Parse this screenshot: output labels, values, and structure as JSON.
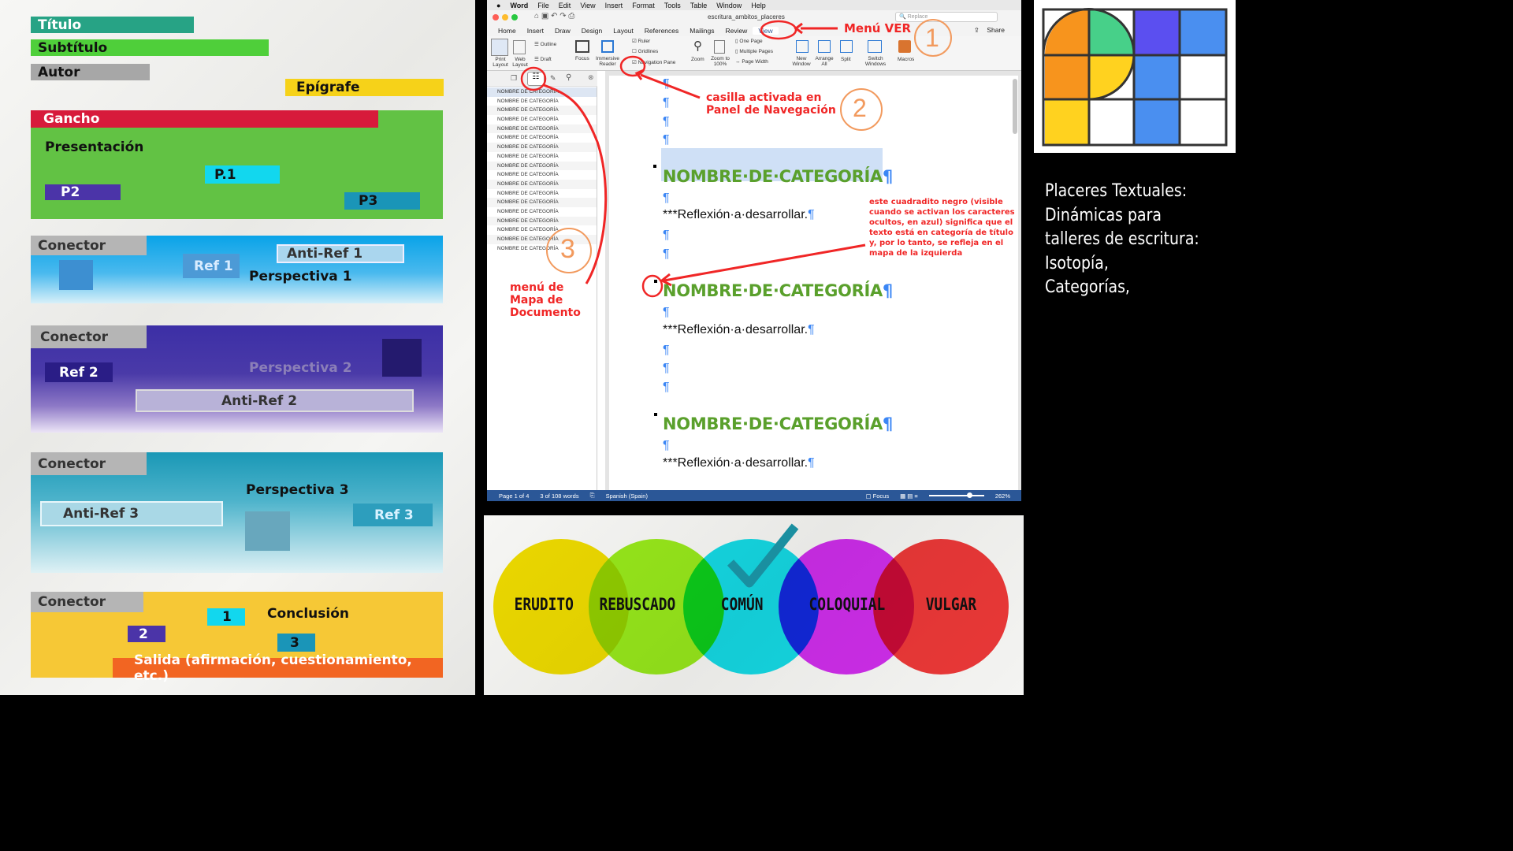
{
  "left": {
    "titulo": "Título",
    "subtitulo": "Subtítulo",
    "autor": "Autor",
    "epigrafe": "Epígrafe",
    "gancho": "Gancho",
    "presentacion": "Presentación",
    "p1": "P.1",
    "p2": "P2",
    "p3": "P3",
    "conector": "Conector",
    "ref1": "Ref 1",
    "antiref1": "Anti-Ref 1",
    "persp1": "Perspectiva 1",
    "ref2": "Ref 2",
    "persp2": "Perspectiva 2",
    "antiref2": "Anti-Ref 2",
    "persp3": "Perspectiva 3",
    "antiref3": "Anti-Ref 3",
    "ref3": "Ref 3",
    "uno": "1",
    "conclusion": "Conclusión",
    "dos": "2",
    "tres": "3",
    "salida": "Salida (afirmación, cuestionamiento, etc.)"
  },
  "word": {
    "menubar": [
      "Word",
      "File",
      "Edit",
      "View",
      "Insert",
      "Format",
      "Tools",
      "Table",
      "Window",
      "Help"
    ],
    "doc_title": "escritura_ambitos_placeres",
    "search_placeholder": "Replace",
    "tabs": [
      "Home",
      "Insert",
      "Draw",
      "Design",
      "Layout",
      "References",
      "Mailings",
      "Review",
      "View"
    ],
    "share": "Share",
    "ribbon": {
      "print_layout": "Print Layout",
      "web_layout": "Web Layout",
      "outline": "Outline",
      "draft": "Draft",
      "focus": "Focus",
      "immersive_reader": "Immersive Reader",
      "ruler": "Ruler",
      "gridlines": "Gridlines",
      "navigation_pane": "Navigation Pane",
      "zoom": "Zoom",
      "zoom_100": "Zoom to 100%",
      "one_page": "One Page",
      "multiple_pages": "Multiple Pages",
      "page_width": "Page Width",
      "new_window": "New Window",
      "arrange_all": "Arrange All",
      "split": "Split",
      "switch_windows": "Switch Windows",
      "macros": "Macros"
    },
    "nav_items": [
      "NOMBRE DE CATEGORÍA",
      "NOMBRE DE CATEGORÍA",
      "NOMBRE DE CATEGORÍA",
      "NOMBRE DE CATEGORÍA",
      "NOMBRE DE CATEGORÍA",
      "NOMBRE DE CATEGORÍA",
      "NOMBRE DE CATEGORÍA",
      "NOMBRE DE CATEGORÍA",
      "NOMBRE DE CATEGORÍA",
      "NOMBRE DE CATEGORÍA",
      "NOMBRE DE CATEGORÍA",
      "NOMBRE DE CATEGORÍA",
      "NOMBRE DE CATEGORÍA",
      "NOMBRE DE CATEGORÍA",
      "NOMBRE DE CATEGORÍA",
      "NOMBRE DE CATEGORÍA",
      "NOMBRE DE CATEGORÍA",
      "NOMBRE DE CATEGORÍA"
    ],
    "pilcrow": "¶",
    "heading": "NOMBRE·DE·CATEGORÍA",
    "reflexion": "***Reflexión·a·desarrollar.",
    "status": {
      "page": "Page 1 of 4",
      "words": "3 of 108 words",
      "language": "Spanish (Spain)",
      "focus": "Focus",
      "zoom": "262%"
    },
    "annotations": {
      "menu_ver": "Menú VER",
      "casilla": "casilla activada en Panel de Navegación",
      "menu_mapa": "menú de Mapa de Documento",
      "nota": "este cuadradito negro (visible cuando se activan los caracteres ocultos, en azul) significa que el texto está en categoría de título y, por lo tanto, se refleja en el mapa de la izquierda",
      "num1": "1",
      "num2": "2",
      "num3": "3"
    }
  },
  "venn": [
    "ERUDITO",
    "REBUSCADO",
    "COMÚN",
    "COLOQUIAL",
    "VULGAR"
  ],
  "side_text": [
    "Placeres Textuales:",
    "Dinámicas para",
    "talleres de escritura:",
    "Isotopía,",
    "Categorías,"
  ]
}
